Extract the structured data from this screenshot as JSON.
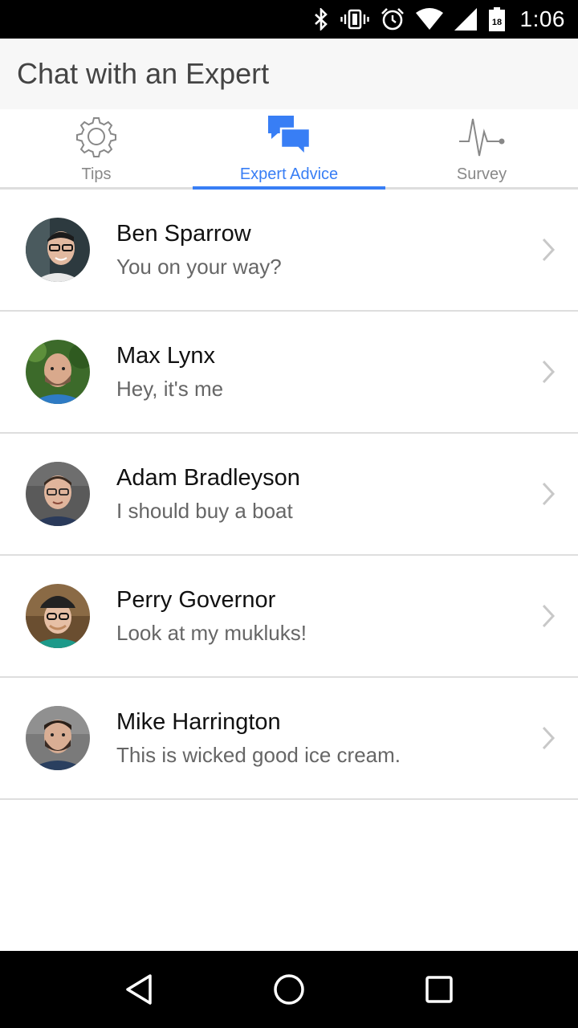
{
  "status_bar": {
    "time": "1:06",
    "battery_level": "18",
    "icons": [
      "bluetooth-icon",
      "vibrate-icon",
      "alarm-icon",
      "wifi-icon",
      "signal-icon",
      "battery-icon"
    ]
  },
  "header": {
    "title": "Chat with an Expert"
  },
  "tabs": [
    {
      "label": "Tips",
      "icon": "gear-icon",
      "active": false
    },
    {
      "label": "Expert Advice",
      "icon": "chat-bubbles-icon",
      "active": true
    },
    {
      "label": "Survey",
      "icon": "pulse-icon",
      "active": false
    }
  ],
  "chats": [
    {
      "name": "Ben Sparrow",
      "message": "You on your way?"
    },
    {
      "name": "Max Lynx",
      "message": "Hey, it's me"
    },
    {
      "name": "Adam Bradleyson",
      "message": "I should buy a boat"
    },
    {
      "name": "Perry Governor",
      "message": "Look at my mukluks!"
    },
    {
      "name": "Mike Harrington",
      "message": "This is wicked good ice cream."
    }
  ],
  "colors": {
    "accent": "#387ef5",
    "status_bar": "#000000",
    "header_bg": "#f7f7f7"
  },
  "nav_bar": {
    "icons": [
      "back-icon",
      "home-icon",
      "recents-icon"
    ]
  }
}
